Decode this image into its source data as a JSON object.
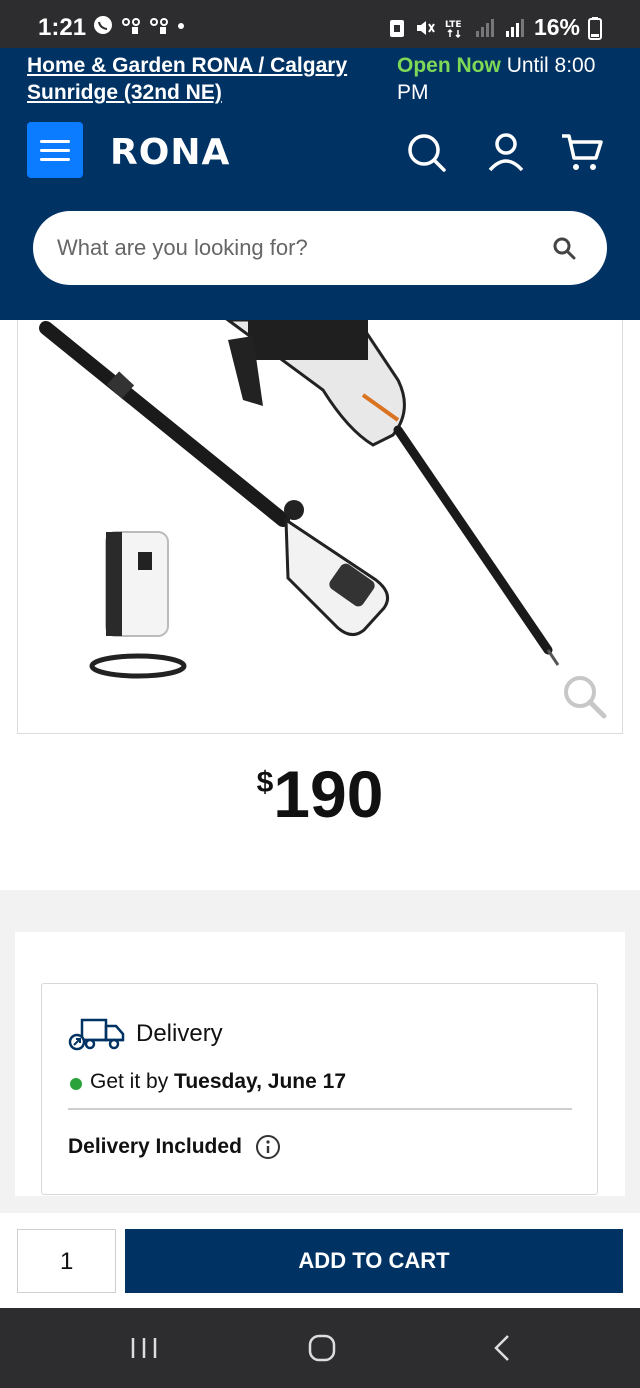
{
  "status_bar": {
    "time": "1:21",
    "battery": "16%"
  },
  "store": {
    "name": "Home & Garden RONA / Calgary Sunridge (32nd NE)",
    "open_status": "Open Now",
    "hours": "Until 8:00 PM"
  },
  "header": {
    "logo": "RONA",
    "search_placeholder": "What are you looking for?"
  },
  "product": {
    "price_symbol": "$",
    "price_value": "190"
  },
  "delivery": {
    "title": "Delivery",
    "get_it_prefix": "Get it by",
    "get_it_date": "Tuesday, June 17",
    "included": "Delivery Included"
  },
  "cart": {
    "quantity": "1",
    "add_label": "ADD TO CART"
  },
  "colors": {
    "brand_navy": "#003263",
    "menu_blue": "#0b7cff",
    "open_green": "#7ed957",
    "dot_green": "#2ba33a"
  },
  "icons": [
    "whatsapp-icon",
    "voicemail-icon",
    "mute-icon",
    "lte-icon",
    "signal-icon",
    "battery-icon",
    "menu-icon",
    "search-icon",
    "account-icon",
    "cart-icon",
    "zoom-icon",
    "truck-icon",
    "info-icon",
    "recent-apps-icon",
    "home-icon",
    "back-icon"
  ]
}
